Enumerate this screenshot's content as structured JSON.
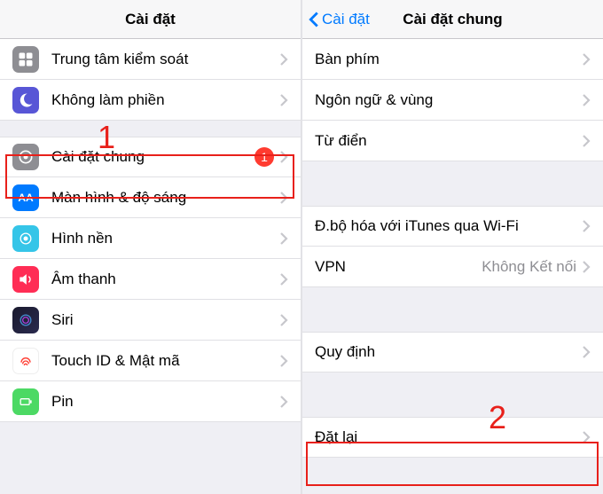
{
  "left": {
    "title": "Cài đặt",
    "annotation": "1",
    "rows": [
      {
        "key": "control-center",
        "label": "Trung tâm kiểm soát",
        "icon": "control-center-icon",
        "bg": "#8e8e93"
      },
      {
        "key": "dnd",
        "label": "Không làm phiền",
        "icon": "moon-icon",
        "bg": "#5856d6"
      },
      {
        "key": "general",
        "label": "Cài đặt chung",
        "icon": "gear-icon",
        "bg": "#8e8e93",
        "badge": "1",
        "highlight": true
      },
      {
        "key": "display",
        "label": "Màn hình & độ sáng",
        "icon": "display-icon",
        "bg": "#007aff"
      },
      {
        "key": "wallpaper",
        "label": "Hình nền",
        "icon": "wallpaper-icon",
        "bg": "#35c5e8"
      },
      {
        "key": "sounds",
        "label": "Âm thanh",
        "icon": "sounds-icon",
        "bg": "#ff2d55"
      },
      {
        "key": "siri",
        "label": "Siri",
        "icon": "siri-icon",
        "bg": "#000"
      },
      {
        "key": "touchid",
        "label": "Touch ID & Mật mã",
        "icon": "touchid-icon",
        "bg": "#ff3b30"
      },
      {
        "key": "pin",
        "label": "Pin",
        "icon": "battery-icon",
        "bg": "#4cd964"
      }
    ]
  },
  "right": {
    "title": "Cài đặt chung",
    "back": "Cài đặt",
    "annotation": "2",
    "rows": [
      {
        "key": "keyboard",
        "label": "Bàn phím"
      },
      {
        "key": "language",
        "label": "Ngôn ngữ & vùng"
      },
      {
        "key": "dictionary",
        "label": "Từ điển"
      },
      {
        "key": "itunes",
        "label": "Đ.bộ hóa với iTunes qua Wi-Fi"
      },
      {
        "key": "vpn",
        "label": "VPN",
        "value": "Không Kết nối"
      },
      {
        "key": "regulatory",
        "label": "Quy định"
      },
      {
        "key": "reset",
        "label": "Đặt lại",
        "highlight": true
      }
    ]
  }
}
